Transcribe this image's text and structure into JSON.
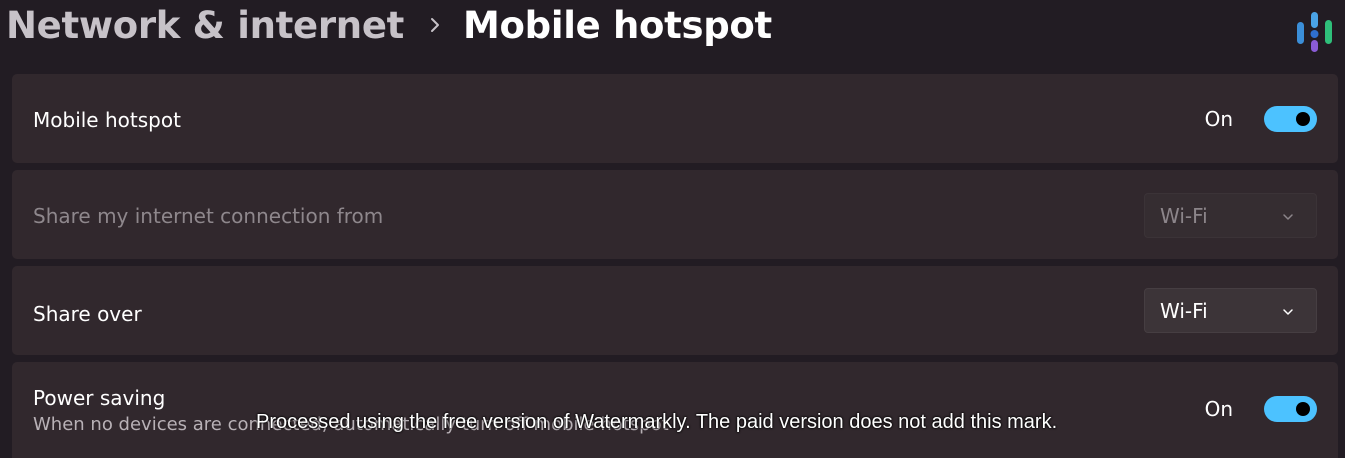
{
  "header": {
    "parent": "Network & internet",
    "separator_icon": "chevron-right-icon",
    "current": "Mobile hotspot"
  },
  "brand": {
    "logo_icon": "brand-logo-bars",
    "colors": [
      "#3b8ed8",
      "#8a5cd6",
      "#2fbf7a"
    ]
  },
  "settings": {
    "hotspot": {
      "label": "Mobile hotspot",
      "state": "On",
      "enabled": true
    },
    "share_from": {
      "label": "Share my internet connection from",
      "value": "Wi-Fi",
      "disabled": true
    },
    "share_over": {
      "label": "Share over",
      "value": "Wi-Fi"
    },
    "power_saving": {
      "label": "Power saving",
      "description": "When no devices are connected, automatically turn off mobile hotspot",
      "state": "On",
      "enabled": true
    }
  },
  "watermark": {
    "text": "Processed using the free version of Watermarkly. The paid version does not add this mark."
  },
  "colors": {
    "background": "#221c23",
    "card": "#31282d",
    "accent": "#4cc2ff"
  }
}
